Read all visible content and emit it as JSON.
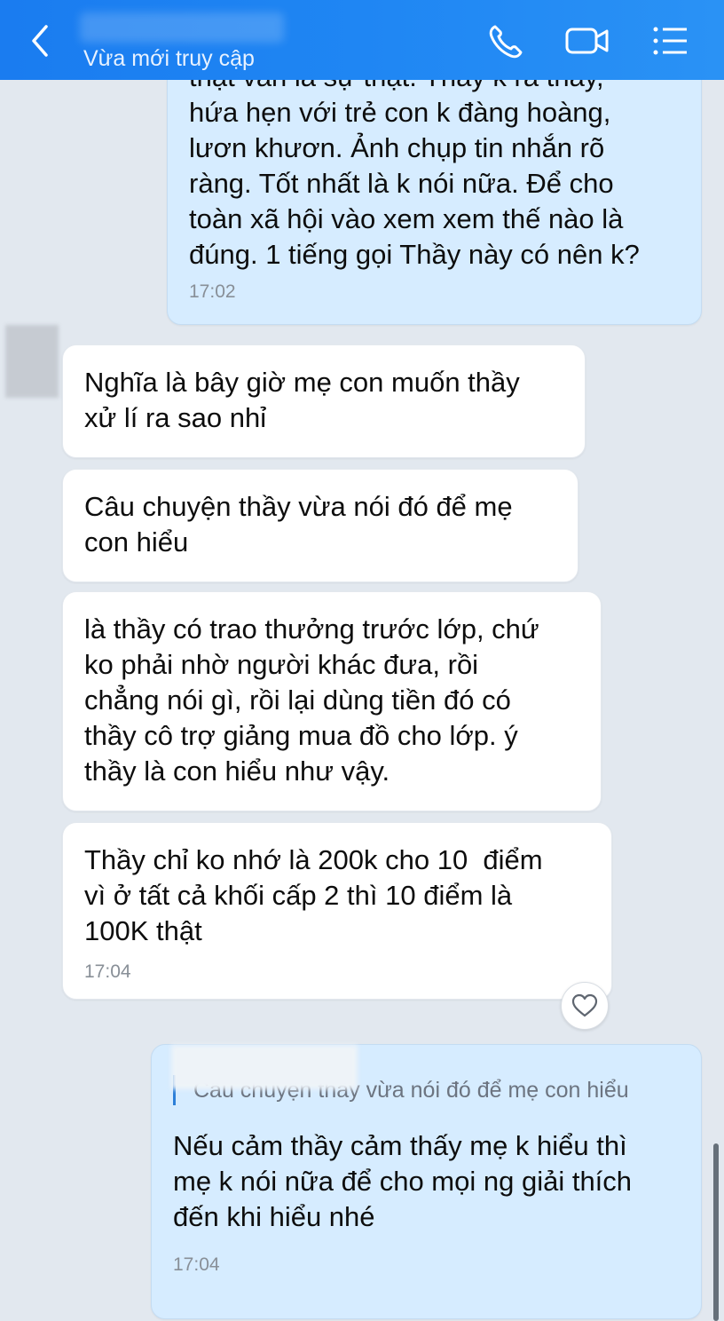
{
  "header": {
    "status": "Vừa mới truy cập",
    "back_icon": "chevron-left-icon",
    "call_icon": "phone-icon",
    "video_icon": "video-camera-icon",
    "menu_icon": "list-menu-icon"
  },
  "messages": [
    {
      "cropped_line": "thật vẫn là sự thật. Thầy k ra thầy,",
      "text": "hứa hẹn với trẻ con k đàng hoàng,\nlươn khươn. Ảnh chụp tin nhắn rõ\nràng. Tốt nhất là k nói nữa. Để cho\ntoàn xã hội vào xem xem thế nào là\nđúng. 1 tiếng gọi Thầy này có nên k?",
      "time": "17:02"
    },
    {
      "text": "Nghĩa là bây giờ mẹ con muốn thầy\nxử lí ra sao nhỉ"
    },
    {
      "text": "Câu chuyện thầy vừa nói đó để mẹ\ncon hiểu"
    },
    {
      "text": "là thầy có trao thưởng trước lớp, chứ\nko phải nhờ người khác đưa, rồi\nchẳng nói gì, rồi lại dùng tiền đó có\nthầy cô trợ giảng mua đồ cho lớp. ý\nthầy là con hiểu như vậy."
    },
    {
      "text": "Thầy chỉ ko nhớ là 200k cho 10  điểm\nvì ở tất cả khối cấp 2 thì 10 điểm là\n100K thật",
      "time": "17:04"
    },
    {
      "quote": "Câu chuyện thầy vừa nói đó để mẹ con hiểu",
      "text": "Nếu cảm thầy cảm thấy mẹ k hiểu thì\nmẹ k nói nữa để cho mọi ng giải thích\nđến khi hiểu nhé",
      "time": "17:04"
    }
  ],
  "reaction_icon": "heart-icon",
  "colors": {
    "header": "#1f86f3",
    "outgoing_bubble": "#d6ecff",
    "incoming_bubble": "#ffffff",
    "background": "#e2e8ef"
  }
}
